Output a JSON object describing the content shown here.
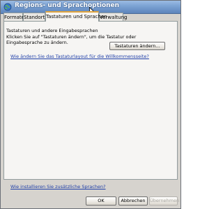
{
  "window": {
    "title": "Regions- und Sprachoptionen"
  },
  "tabs": [
    {
      "label": "Formate"
    },
    {
      "label": "Standort"
    },
    {
      "label": "Tastaturen und Sprachen"
    },
    {
      "label": "Verwaltung"
    }
  ],
  "active_tab": "Tastaturen und Sprachen",
  "keyboards_group": {
    "title": "Tastaturen und andere Eingabesprachen",
    "description": "Klicken Sie auf \"Tastaturen ändern\", um die Tastatur oder Eingabesprache zu ändern.",
    "button_label": "Tastaturen ändern..."
  },
  "links": {
    "welcome_layout": "Wie ändern Sie das Tastaturlayout für die Willkommensseite?",
    "install_languages": "Wie installieren Sie zusätzliche Sprachen?"
  },
  "footer": {
    "ok_label": "OK",
    "cancel_label": "Abbrechen",
    "apply_label": "Übernehmen"
  },
  "colors": {
    "title_bar": "#7aa1d2",
    "active_tab_accent": "#e0a53f",
    "link": "#1e3ea8"
  }
}
